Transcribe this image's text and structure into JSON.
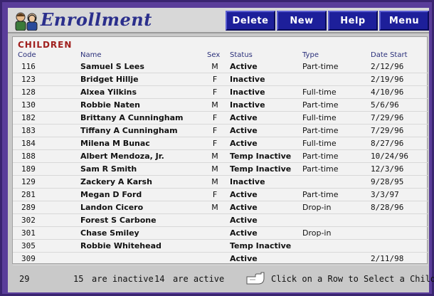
{
  "header": {
    "title": "Enrollment",
    "buttons": {
      "delete": "Delete",
      "new": "New",
      "help": "Help",
      "menu": "Menu"
    }
  },
  "list": {
    "section_title": "CHILDREN",
    "columns": {
      "code": "Code",
      "name": "Name",
      "sex": "Sex",
      "status": "Status",
      "type": "Type",
      "date": "Date Start"
    },
    "rows": [
      {
        "code": "116",
        "name": "Samuel S Lees",
        "sex": "M",
        "status": "Active",
        "type": "Part-time",
        "date": "2/12/96"
      },
      {
        "code": "123",
        "name": "Bridget Hillje",
        "sex": "F",
        "status": "Inactive",
        "type": "",
        "date": "2/19/96"
      },
      {
        "code": "128",
        "name": "Alxea Yilkins",
        "sex": "F",
        "status": "Inactive",
        "type": "Full-time",
        "date": "4/10/96"
      },
      {
        "code": "130",
        "name": "Robbie Naten",
        "sex": "M",
        "status": "Inactive",
        "type": "Part-time",
        "date": "5/6/96"
      },
      {
        "code": "182",
        "name": "Brittany A Cunningham",
        "sex": "F",
        "status": "Active",
        "type": "Full-time",
        "date": "7/29/96"
      },
      {
        "code": "183",
        "name": "Tiffany A Cunningham",
        "sex": "F",
        "status": "Active",
        "type": "Part-time",
        "date": "7/29/96"
      },
      {
        "code": "184",
        "name": "Milena M Bunac",
        "sex": "F",
        "status": "Active",
        "type": "Full-time",
        "date": "8/27/96"
      },
      {
        "code": "188",
        "name": "Albert Mendoza, Jr.",
        "sex": "M",
        "status": "Temp Inactive",
        "type": "Part-time",
        "date": "10/24/96"
      },
      {
        "code": "189",
        "name": "Sam R Smith",
        "sex": "M",
        "status": "Temp Inactive",
        "type": "Part-time",
        "date": "12/3/96"
      },
      {
        "code": "129",
        "name": "Zackery A Karsh",
        "sex": "M",
        "status": "Inactive",
        "type": "",
        "date": "9/28/95"
      },
      {
        "code": "281",
        "name": "Megan D Ford",
        "sex": "F",
        "status": "Active",
        "type": "Part-time",
        "date": "3/3/97"
      },
      {
        "code": "289",
        "name": "Landon Cicero",
        "sex": "M",
        "status": "Active",
        "type": "Drop-in",
        "date": "8/28/96"
      },
      {
        "code": "302",
        "name": "Forest S Carbone",
        "sex": "",
        "status": "Active",
        "type": "",
        "date": ""
      },
      {
        "code": "301",
        "name": "Chase Smiley",
        "sex": "",
        "status": "Active",
        "type": "Drop-in",
        "date": ""
      },
      {
        "code": "305",
        "name": "Robbie Whitehead",
        "sex": "",
        "status": "Temp Inactive",
        "type": "",
        "date": ""
      },
      {
        "code": "309",
        "name": "",
        "sex": "",
        "status": "Active",
        "type": "",
        "date": "2/11/98"
      }
    ]
  },
  "footer": {
    "total": "29",
    "inactive_count": "15",
    "inactive_label": "are inactive",
    "active_count": "14",
    "active_label": "are active",
    "hint": "Click on a Row to Select a Child"
  },
  "icons": {
    "logo": "children-logo-icon",
    "hint": "pointing-hand-icon"
  },
  "colors": {
    "accent": "#1d1f9a",
    "title": "#2b2f8c",
    "section": "#a0201e",
    "frame": "#5a3d9a"
  }
}
